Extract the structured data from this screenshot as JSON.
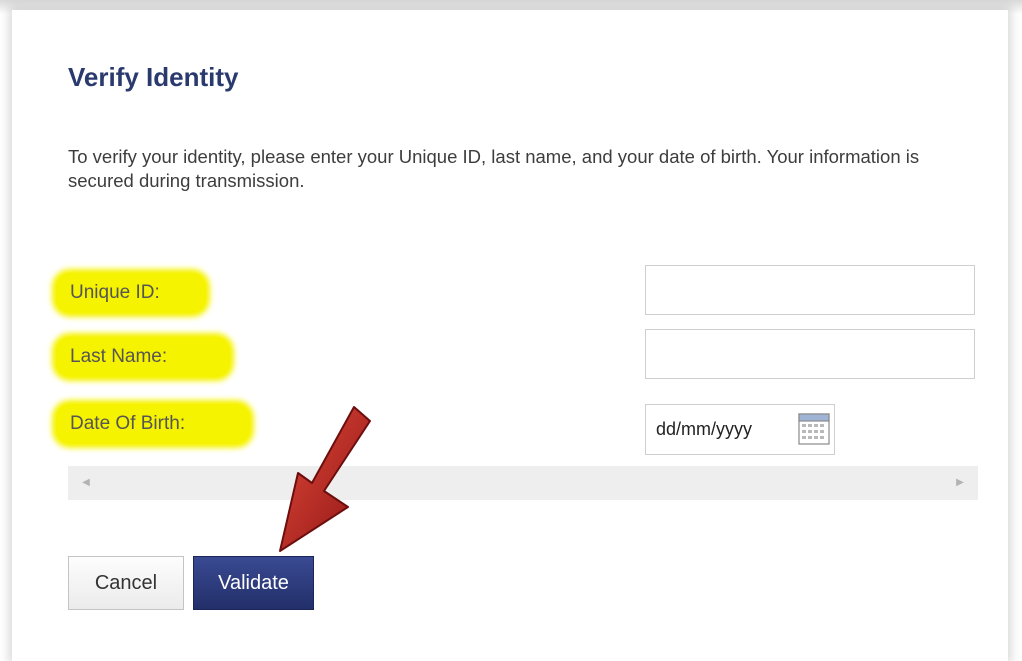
{
  "page": {
    "title": "Verify Identity",
    "instructions": "To verify your identity, please enter your Unique ID, last name, and your date of birth. Your information is secured during transmission."
  },
  "form": {
    "unique_id": {
      "label": "Unique ID:",
      "value": ""
    },
    "last_name": {
      "label": "Last Name:",
      "value": ""
    },
    "date_of_birth": {
      "label": "Date Of Birth:",
      "placeholder": "dd/mm/yyyy",
      "icon": "calendar-icon"
    }
  },
  "scrollbar": {
    "left_arrow": "◀",
    "right_arrow": "▶"
  },
  "buttons": {
    "cancel": "Cancel",
    "validate": "Validate"
  },
  "annotations": {
    "arrow": "red-arrow-pointing-to-validate",
    "highlight_color": "#f6f300"
  },
  "colors": {
    "title": "#2a3a6e",
    "validate_bg": "#2b3878",
    "highlight": "#f6f300",
    "arrow": "#b01e1e"
  }
}
